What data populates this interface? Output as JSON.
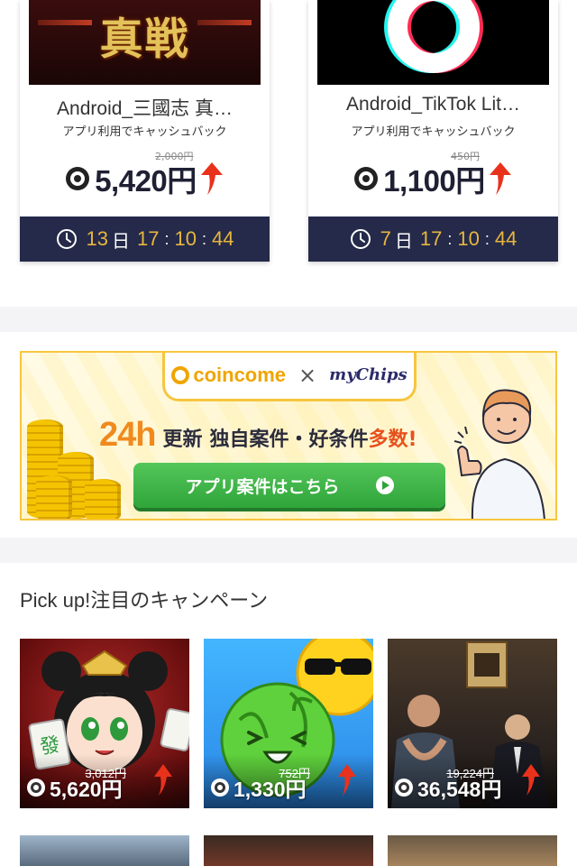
{
  "featured": [
    {
      "title": "Android_三國志 真…",
      "subtitle": "アプリ利用でキャッシュバック",
      "old_price": "2,000円",
      "price": "5,420円",
      "timer": {
        "days": "13",
        "day_unit": "日",
        "hours": "17",
        "minutes": "10",
        "seconds": "44"
      }
    },
    {
      "title": "Android_TikTok Lit…",
      "subtitle": "アプリ利用でキャッシュバック",
      "old_price": "450円",
      "price": "1,100円",
      "timer": {
        "days": "7",
        "day_unit": "日",
        "hours": "17",
        "minutes": "10",
        "seconds": "44"
      }
    }
  ],
  "banner": {
    "brand_left": "coincome",
    "times": "×",
    "brand_right": "myChips",
    "headline_24h": "24h",
    "headline_update": "更新",
    "headline_mid": "独自案件・好条件",
    "headline_red": "多数!",
    "button_label": "アプリ案件はこちら"
  },
  "pickup": {
    "title": "Pick up!注目のキャンペーン",
    "items": [
      {
        "old_price": "3,012円",
        "price": "5,620円"
      },
      {
        "old_price": "752円",
        "price": "1,330円"
      },
      {
        "old_price": "19,224円",
        "price": "36,548円"
      }
    ]
  },
  "colors": {
    "navy": "#252a4a",
    "timer_gold": "#e7b63d",
    "price_text": "#1f2033",
    "arrow_red": "#e8321c",
    "button_green": "#2fa53a",
    "banner_border": "#f7c53f"
  }
}
